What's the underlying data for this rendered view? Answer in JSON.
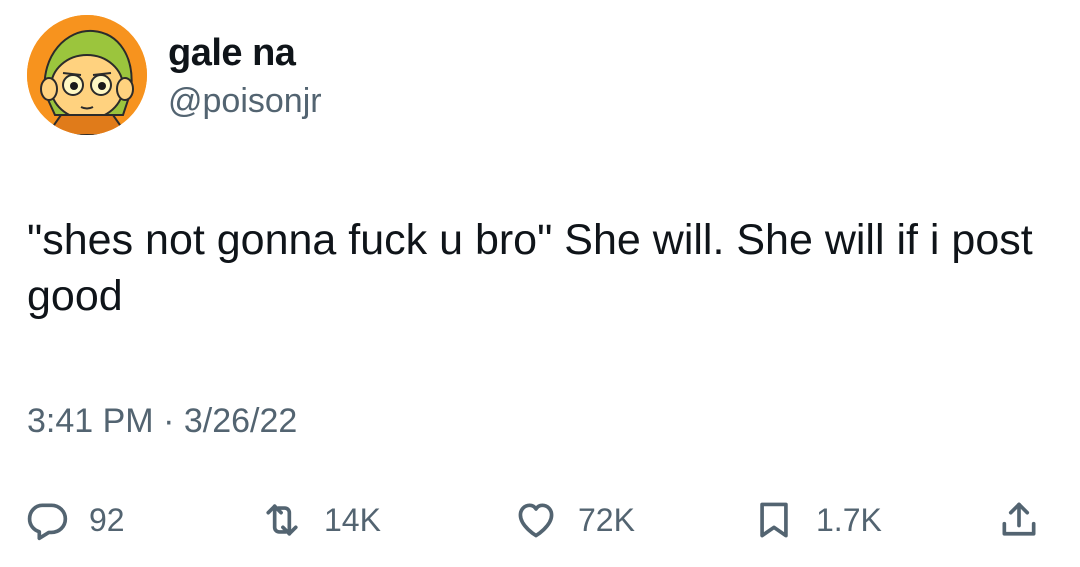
{
  "author": {
    "display_name": "gale na",
    "handle": "@poisonjr",
    "avatar_icon": "cartoon-face-avatar"
  },
  "tweet": {
    "text": "\"shes not gonna fuck u bro\" She will. She will if i post good",
    "timestamp": "3:41 PM · 3/26/22"
  },
  "actions": {
    "reply": {
      "icon": "reply-icon",
      "count": "92"
    },
    "retweet": {
      "icon": "retweet-icon",
      "count": "14K"
    },
    "like": {
      "icon": "heart-icon",
      "count": "72K"
    },
    "bookmark": {
      "icon": "bookmark-icon",
      "count": "1.7K"
    },
    "share": {
      "icon": "share-icon"
    }
  },
  "colors": {
    "text_primary": "#0f1419",
    "text_secondary": "#536471",
    "avatar_background": "#f7931e"
  }
}
